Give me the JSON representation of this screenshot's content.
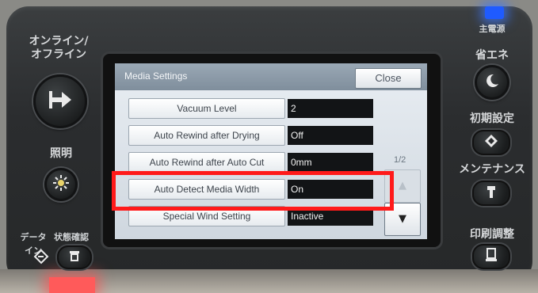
{
  "left_panel": {
    "online_offline_label": "オンライン/\nオフライン",
    "illumination_label": "照明",
    "data_in_label": "データイン",
    "status_check_label": "状態確認"
  },
  "right_panel": {
    "main_power_label": "主電源",
    "energy_save_label": "省エネ",
    "initial_settings_label": "初期設定",
    "maintenance_label": "メンテナンス",
    "print_adjust_label": "印刷調整"
  },
  "screen": {
    "title": "Media Settings",
    "close_label": "Close",
    "page_indicator": "1/2",
    "rows": [
      {
        "label": "Vacuum Level",
        "value": "2"
      },
      {
        "label": "Auto Rewind after Drying",
        "value": "Off"
      },
      {
        "label": "Auto Rewind after Auto Cut",
        "value": "0mm"
      },
      {
        "label": "Auto Detect Media Width",
        "value": "On"
      },
      {
        "label": "Special Wind Setting",
        "value": "Inactive"
      }
    ]
  },
  "icons": {
    "online": "arrow-into-bar-icon",
    "illumination": "light-icon",
    "data_in": "data-in-icon",
    "status": "status-icon",
    "energy_save": "moon-icon",
    "initial_settings": "diamond-icon",
    "maintenance": "wrench-icon",
    "print_adjust": "print-adjust-icon",
    "scroll_up": "triangle-up-icon",
    "scroll_down": "triangle-down-icon"
  },
  "colors": {
    "highlight": "#ff1a1a",
    "power_led": "#1f5bff",
    "value_field": "#121416"
  }
}
